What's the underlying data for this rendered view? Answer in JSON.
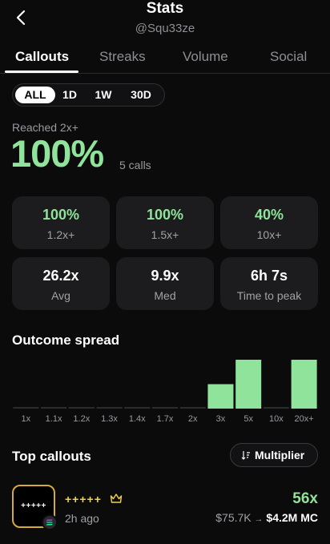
{
  "header": {
    "title": "Stats",
    "handle": "@Squ33ze"
  },
  "tabs": [
    {
      "label": "Callouts",
      "active": true
    },
    {
      "label": "Streaks",
      "active": false
    },
    {
      "label": "Volume",
      "active": false
    },
    {
      "label": "Social",
      "active": false
    }
  ],
  "ranges": [
    {
      "label": "ALL",
      "active": true
    },
    {
      "label": "1D",
      "active": false
    },
    {
      "label": "1W",
      "active": false
    },
    {
      "label": "30D",
      "active": false
    }
  ],
  "summary": {
    "label": "Reached 2x+",
    "value": "100%",
    "calls": "5 calls"
  },
  "cards": [
    {
      "value": "100%",
      "label": "1.2x+",
      "green": true
    },
    {
      "value": "100%",
      "label": "1.5x+",
      "green": true
    },
    {
      "value": "40%",
      "label": "10x+",
      "green": true
    },
    {
      "value": "26.2x",
      "label": "Avg",
      "green": false
    },
    {
      "value": "9.9x",
      "label": "Med",
      "green": false
    },
    {
      "value": "6h 7s",
      "label": "Time to peak",
      "green": false
    }
  ],
  "outcome": {
    "title": "Outcome spread"
  },
  "chart_data": {
    "type": "bar",
    "categories": [
      "1x",
      "1.1x",
      "1.2x",
      "1.3x",
      "1.4x",
      "1.7x",
      "2x",
      "3x",
      "5x",
      "10x",
      "20x+"
    ],
    "values": [
      0,
      0,
      0,
      0,
      0,
      0,
      0,
      1,
      2,
      0,
      2
    ],
    "ylim": [
      0,
      2
    ],
    "grid": false,
    "colors": {
      "bar": "#8fe39a",
      "baseline": "#2c2c2f"
    }
  },
  "top": {
    "title": "Top callouts",
    "sort_label": "Multiplier"
  },
  "callout": {
    "avatar_text": "+++++",
    "name": "+++++",
    "time": "2h ago",
    "multiplier": "56x",
    "mc_from": "$75.7K",
    "arrow": "→",
    "mc_to": "$4.2M MC"
  },
  "colors": {
    "accent_green": "#8fe39a",
    "gold": "#f1d24a",
    "card_bg": "#1c1c1e",
    "bg": "#0b0b0c"
  }
}
